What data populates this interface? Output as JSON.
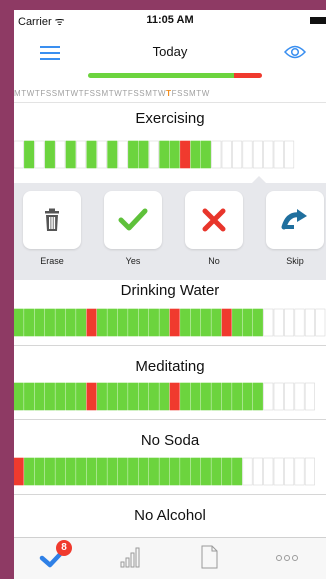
{
  "status_bar": {
    "carrier": "Carrier ᯤ",
    "time": "11:05 AM"
  },
  "nav": {
    "title": "Today",
    "menu_icon": "hamburger-icon",
    "eye_icon": "eye-icon",
    "progress_fraction": 0.84,
    "progress_miss_fraction": 0.16
  },
  "day_strip": {
    "before": "MTWTFSSMTWTFSSMTWTFSSMTW",
    "today": "T",
    "after": "FSSMTW"
  },
  "colors": {
    "done": "#6cd43e",
    "missed": "#f03a2e",
    "empty": "#ffffff",
    "accent": "#3a8ff0",
    "background": "#8e3a64"
  },
  "habits": [
    {
      "id": "exercising",
      "title": "Exercising",
      "days": "EDEDEDEDEDEDDEDDFDDEEEEEEEE"
    },
    {
      "id": "drinking-water",
      "title": "Drinking Water",
      "days": "DDDDDDDFDDDDDDDFDDDDFDDDEEEEEE"
    },
    {
      "id": "meditating",
      "title": "Meditating",
      "days": "DDDDDDDFDDDDDDDFDDDDDDDDEEEEE"
    },
    {
      "id": "no-soda",
      "title": "No Soda",
      "days": "FDDDDDDDDDDDDDDDDDDDDDEEEEEEE"
    },
    {
      "id": "no-alcohol",
      "title": "No Alcohol"
    }
  ],
  "actions": [
    {
      "id": "erase",
      "label": "Erase",
      "icon": "trash-icon"
    },
    {
      "id": "yes",
      "label": "Yes",
      "icon": "checkmark-icon"
    },
    {
      "id": "no",
      "label": "No",
      "icon": "x-icon"
    },
    {
      "id": "skip",
      "label": "Skip",
      "icon": "skip-arrow-icon"
    }
  ],
  "tabbar": {
    "tabs": [
      {
        "id": "today",
        "icon": "checkmark-icon",
        "badge": "8"
      },
      {
        "id": "stats",
        "icon": "signal-bars-icon"
      },
      {
        "id": "notes",
        "icon": "document-icon"
      },
      {
        "id": "more",
        "icon": "more-icon"
      }
    ]
  }
}
